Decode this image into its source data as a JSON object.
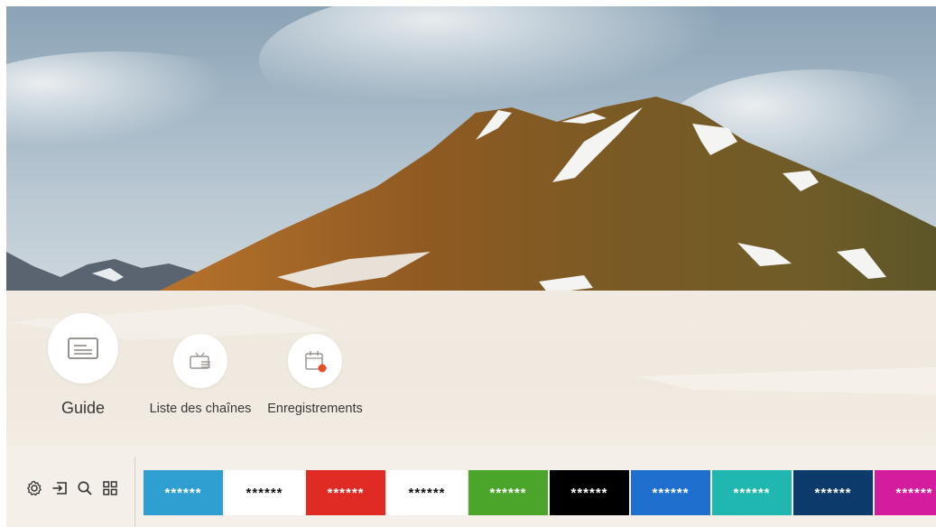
{
  "submenu": {
    "items": [
      {
        "label": "Guide",
        "icon": "guide-icon"
      },
      {
        "label": "Liste des chaînes",
        "icon": "channel-list-icon"
      },
      {
        "label": "Enregistrements",
        "icon": "recordings-icon",
        "accent": "#e5502a"
      }
    ]
  },
  "launcher": {
    "system_icons": [
      "settings-icon",
      "source-icon",
      "search-icon",
      "apps-icon"
    ],
    "apps": [
      {
        "label": "******",
        "bg": "#2f9fd1",
        "fg": "#ffffff"
      },
      {
        "label": "******",
        "bg": "#ffffff",
        "fg": "#111111"
      },
      {
        "label": "******",
        "bg": "#e02a24",
        "fg": "#ffffff"
      },
      {
        "label": "******",
        "bg": "#ffffff",
        "fg": "#111111"
      },
      {
        "label": "******",
        "bg": "#4aa52a",
        "fg": "#ffffff"
      },
      {
        "label": "******",
        "bg": "#000000",
        "fg": "#ffffff"
      },
      {
        "label": "******",
        "bg": "#1f6fcf",
        "fg": "#ffffff"
      },
      {
        "label": "******",
        "bg": "#20b7b0",
        "fg": "#ffffff"
      },
      {
        "label": "******",
        "bg": "#0c3a6b",
        "fg": "#ffffff"
      },
      {
        "label": "******",
        "bg": "#d41c9e",
        "fg": "#ffffff"
      }
    ]
  }
}
